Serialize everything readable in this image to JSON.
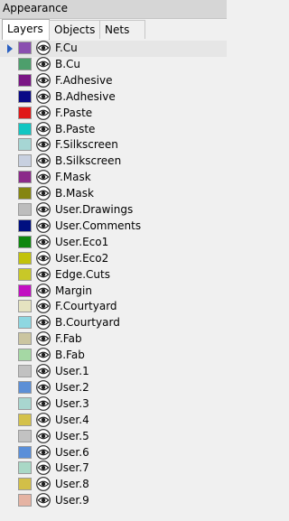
{
  "panel": {
    "title": "Appearance"
  },
  "tabs": [
    {
      "label": "Layers",
      "active": true
    },
    {
      "label": "Objects",
      "active": false
    },
    {
      "label": "Nets",
      "active": false
    }
  ],
  "visibility_icon": "eye-icon",
  "selected_indicator_icon": "triangle-right-icon",
  "layers": [
    {
      "name": "F.Cu",
      "color": "#8a4fb0",
      "selected": true
    },
    {
      "name": "B.Cu",
      "color": "#4d9f6c"
    },
    {
      "name": "F.Adhesive",
      "color": "#7a1585"
    },
    {
      "name": "B.Adhesive",
      "color": "#0a0a86"
    },
    {
      "name": "F.Paste",
      "color": "#e01818"
    },
    {
      "name": "B.Paste",
      "color": "#12c6c2"
    },
    {
      "name": "F.Silkscreen",
      "color": "#a6d6d4"
    },
    {
      "name": "B.Silkscreen",
      "color": "#c8d0e0"
    },
    {
      "name": "F.Mask",
      "color": "#8b2a8a"
    },
    {
      "name": "B.Mask",
      "color": "#858510"
    },
    {
      "name": "User.Drawings",
      "color": "#bdbdbd"
    },
    {
      "name": "User.Comments",
      "color": "#000f80"
    },
    {
      "name": "User.Eco1",
      "color": "#0e870e"
    },
    {
      "name": "User.Eco2",
      "color": "#c2c20a"
    },
    {
      "name": "Edge.Cuts",
      "color": "#c8c828"
    },
    {
      "name": "Margin",
      "color": "#c20ec2"
    },
    {
      "name": "F.Courtyard",
      "color": "#e5e3c0"
    },
    {
      "name": "B.Courtyard",
      "color": "#8ed7e1"
    },
    {
      "name": "F.Fab",
      "color": "#cbc5a0"
    },
    {
      "name": "B.Fab",
      "color": "#a5d8a4"
    },
    {
      "name": "User.1",
      "color": "#c1c1c1"
    },
    {
      "name": "User.2",
      "color": "#5c8fd6"
    },
    {
      "name": "User.3",
      "color": "#a8d6cf"
    },
    {
      "name": "User.4",
      "color": "#d4c14a"
    },
    {
      "name": "User.5",
      "color": "#c2c2c2"
    },
    {
      "name": "User.6",
      "color": "#5a8fd9"
    },
    {
      "name": "User.7",
      "color": "#a9d8c6"
    },
    {
      "name": "User.8",
      "color": "#d2bf48"
    },
    {
      "name": "User.9",
      "color": "#e5b3a3"
    }
  ]
}
